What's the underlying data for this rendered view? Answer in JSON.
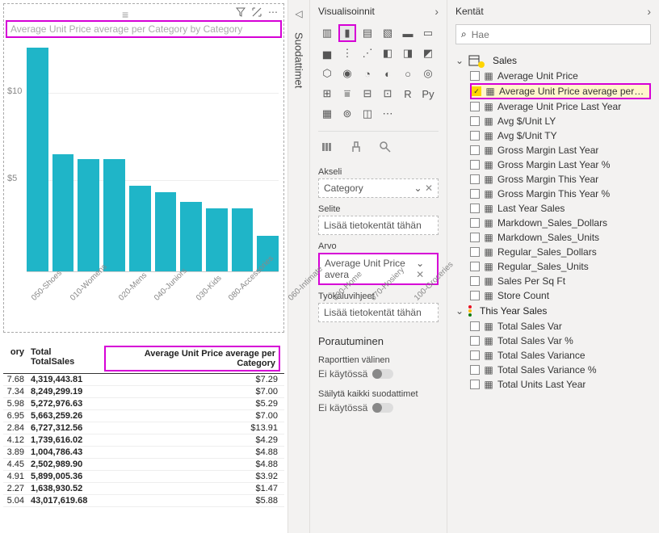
{
  "chart": {
    "title": "Average Unit Price average per Category by Category",
    "toolbar": {
      "grip": "≡",
      "filter_icon": "filter",
      "focus_icon": "focus",
      "more_icon": "more"
    },
    "y_ticks": [
      "$10",
      "$5"
    ]
  },
  "chart_data": {
    "type": "bar",
    "title": "Average Unit Price average per Category by Category",
    "xlabel": "",
    "ylabel": "",
    "ylim": [
      0,
      14
    ],
    "categories": [
      "050-Shoes",
      "010-Womens",
      "020-Mens",
      "040-Juniors",
      "030-Kids",
      "080-Accessories",
      "060-Intimate",
      "090-Home",
      "070-Hosiery",
      "100-Groceries"
    ],
    "values": [
      13.9,
      7.3,
      7.0,
      7.0,
      5.3,
      4.9,
      4.3,
      3.9,
      3.9,
      2.2
    ]
  },
  "table": {
    "headers": {
      "col1": "Total",
      "col1b": "TotalSales",
      "col0": "ory",
      "col2": "Average Unit Price average per Category"
    },
    "rows": [
      {
        "c0": "7.68",
        "c1": "4,319,443.81",
        "c2": "$7.29"
      },
      {
        "c0": "7.34",
        "c1": "8,249,299.19",
        "c2": "$7.00"
      },
      {
        "c0": "5.98",
        "c1": "5,272,976.63",
        "c2": "$5.29"
      },
      {
        "c0": "6.95",
        "c1": "5,663,259.26",
        "c2": "$7.00"
      },
      {
        "c0": "2.84",
        "c1": "6,727,312.56",
        "c2": "$13.91"
      },
      {
        "c0": "4.12",
        "c1": "1,739,616.02",
        "c2": "$4.29"
      },
      {
        "c0": "3.89",
        "c1": "1,004,786.43",
        "c2": "$4.88"
      },
      {
        "c0": "4.45",
        "c1": "2,502,989.90",
        "c2": "$4.88"
      },
      {
        "c0": "4.91",
        "c1": "5,899,005.36",
        "c2": "$3.92"
      },
      {
        "c0": "2.27",
        "c1": "1,638,930.52",
        "c2": "$1.47"
      },
      {
        "c0": "5.04",
        "c1": "43,017,619.68",
        "c2": "$5.88"
      }
    ]
  },
  "filter_panel": {
    "label": "Suodattimet"
  },
  "viz_pane": {
    "title": "Visualisoinnit",
    "section_axis": "Akseli",
    "section_legend": "Selite",
    "section_value": "Arvo",
    "section_tooltip": "Työkaluvihjeet",
    "axis_field": "Category",
    "legend_placeholder": "Lisää tietokentät tähän",
    "value_field": "Average Unit Price avera",
    "tooltip_placeholder": "Lisää tietokentät tähän",
    "drill_title": "Porautuminen",
    "drill_cross": "Raporttien välinen",
    "drill_keep": "Säilytä kaikki suodattimet",
    "toggle_off": "Ei käytössä"
  },
  "fields_pane": {
    "title": "Kentät",
    "search_placeholder": "Hae",
    "table1": "Sales",
    "table2": "This Year Sales",
    "sales_fields": [
      {
        "label": "Average Unit Price",
        "checked": false,
        "calc": true,
        "hl": false
      },
      {
        "label": "Average Unit Price average per Cate...",
        "checked": true,
        "calc": true,
        "hl": true
      },
      {
        "label": "Average Unit Price Last Year",
        "checked": false,
        "calc": true,
        "hl": false
      },
      {
        "label": "Avg $/Unit LY",
        "checked": false,
        "calc": true,
        "hl": false
      },
      {
        "label": "Avg $/Unit TY",
        "checked": false,
        "calc": true,
        "hl": false
      },
      {
        "label": "Gross Margin Last Year",
        "checked": false,
        "calc": true,
        "hl": false
      },
      {
        "label": "Gross Margin Last Year %",
        "checked": false,
        "calc": true,
        "hl": false
      },
      {
        "label": "Gross Margin This Year",
        "checked": false,
        "calc": true,
        "hl": false
      },
      {
        "label": "Gross Margin This Year %",
        "checked": false,
        "calc": true,
        "hl": false
      },
      {
        "label": "Last Year Sales",
        "checked": false,
        "calc": true,
        "hl": false
      },
      {
        "label": "Markdown_Sales_Dollars",
        "checked": false,
        "calc": true,
        "hl": false
      },
      {
        "label": "Markdown_Sales_Units",
        "checked": false,
        "calc": true,
        "hl": false
      },
      {
        "label": "Regular_Sales_Dollars",
        "checked": false,
        "calc": true,
        "hl": false
      },
      {
        "label": "Regular_Sales_Units",
        "checked": false,
        "calc": true,
        "hl": false
      },
      {
        "label": "Sales Per Sq Ft",
        "checked": false,
        "calc": true,
        "hl": false
      },
      {
        "label": "Store Count",
        "checked": false,
        "calc": true,
        "hl": false
      }
    ],
    "tys_fields": [
      {
        "label": "Total Sales Var",
        "checked": false,
        "calc": true
      },
      {
        "label": "Total Sales Var %",
        "checked": false,
        "calc": true
      },
      {
        "label": "Total Sales Variance",
        "checked": false,
        "calc": true
      },
      {
        "label": "Total Sales Variance %",
        "checked": false,
        "calc": true
      },
      {
        "label": "Total Units Last Year",
        "checked": false,
        "calc": true
      }
    ]
  }
}
